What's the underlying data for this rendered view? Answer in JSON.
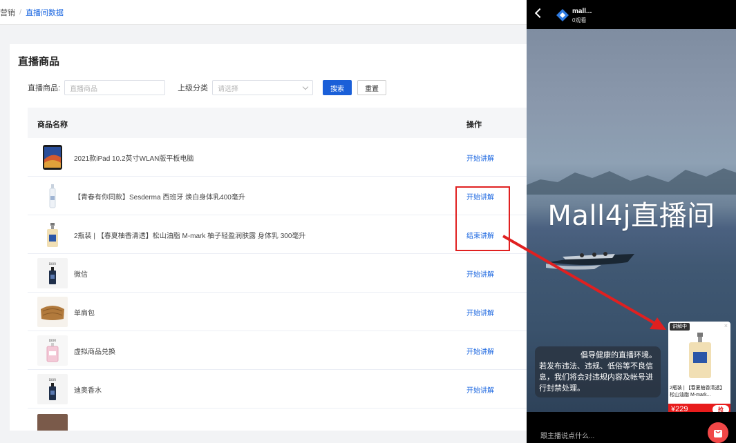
{
  "breadcrumb": {
    "root": "营销",
    "separator": "/",
    "current": "直播间数据"
  },
  "panel": {
    "title": "直播商品"
  },
  "filters": {
    "product_label": "直播商品:",
    "product_placeholder": "直播商品",
    "category_label": "上级分类",
    "category_placeholder": "请选择",
    "search_label": "搜索",
    "reset_label": "重置"
  },
  "table": {
    "columns": [
      "商品名称",
      "操作"
    ],
    "rows": [
      {
        "name": "2021款iPad 10.2英寸WLAN版平板电脑",
        "action": "开始讲解",
        "thumb": "tablet"
      },
      {
        "name": "【青春有你同款】Sesderma 西班牙 焕白身体乳400毫升",
        "action": "开始讲解",
        "thumb": "lotion"
      },
      {
        "name": "2瓶装 | 【春夏柚香清透】松山油脂 M-mark 柚子轻盈润肤露 身体乳 300毫升",
        "action": "结束讲解",
        "thumb": "pump-bottle"
      },
      {
        "name": "微信",
        "action": "开始讲解",
        "thumb": "perfume"
      },
      {
        "name": "单肩包",
        "action": "开始讲解",
        "thumb": "bag"
      },
      {
        "name": "虚拟商品兑换",
        "action": "开始讲解",
        "thumb": "perfume-pink"
      },
      {
        "name": "迪奥香水",
        "action": "开始讲解",
        "thumb": "perfume"
      }
    ]
  },
  "live": {
    "name": "mall...",
    "views": "0观看",
    "title": "Mall4j直播间",
    "notice_lines": [
      "倡导健康的直播环境。",
      "若发布违法、违规、低俗等不良信",
      "息，我们将会对违规内容及帐号进",
      "行封禁处理。"
    ],
    "card": {
      "badge": "讲解中",
      "close": "×",
      "name": "2瓶装 | 【春夏柚香清透】松山油脂 M-mark...",
      "price": "¥229",
      "buy": "抢"
    },
    "chat_placeholder": "跟主播说点什么..."
  },
  "colors": {
    "accent": "#1a5fd8",
    "link": "#1a66e0",
    "highlight": "#e02020",
    "price": "#e81c1c"
  }
}
